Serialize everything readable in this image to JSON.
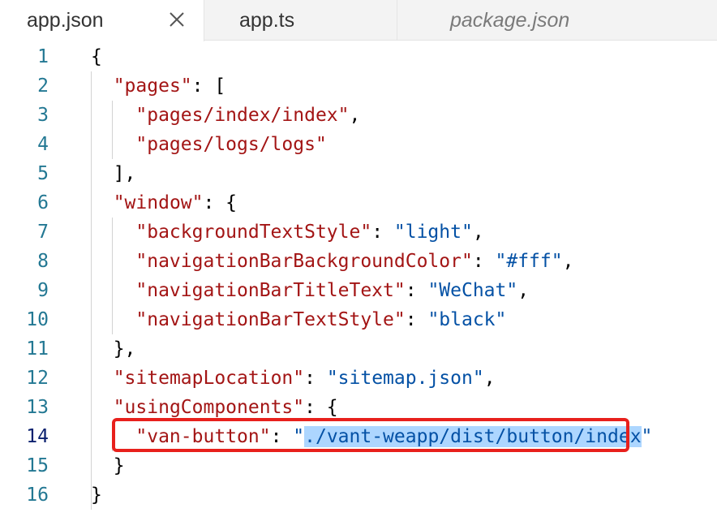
{
  "tabs": [
    {
      "label": "app.json",
      "active": true
    },
    {
      "label": "app.ts",
      "active": false
    },
    {
      "label": "package.json",
      "active": false,
      "preview": true
    }
  ],
  "icons": {
    "tab_close": "close-icon"
  },
  "colors": {
    "key": "#a31515",
    "string": "#0451a5",
    "line_number": "#237893",
    "highlight_border": "#e8201c",
    "selection": "#add6ff"
  },
  "editor": {
    "current_line": 14,
    "lines": [
      {
        "num": "1",
        "parts": [
          {
            "t": "{",
            "c": "p"
          }
        ]
      },
      {
        "num": "2",
        "parts": [
          {
            "t": "  ",
            "c": "p"
          },
          {
            "t": "\"pages\"",
            "c": "k"
          },
          {
            "t": ": [",
            "c": "p"
          }
        ]
      },
      {
        "num": "3",
        "parts": [
          {
            "t": "    ",
            "c": "p"
          },
          {
            "t": "\"pages/index/index\"",
            "c": "k"
          },
          {
            "t": ",",
            "c": "p"
          }
        ]
      },
      {
        "num": "4",
        "parts": [
          {
            "t": "    ",
            "c": "p"
          },
          {
            "t": "\"pages/logs/logs\"",
            "c": "k"
          }
        ]
      },
      {
        "num": "5",
        "parts": [
          {
            "t": "  ],",
            "c": "p"
          }
        ]
      },
      {
        "num": "6",
        "parts": [
          {
            "t": "  ",
            "c": "p"
          },
          {
            "t": "\"window\"",
            "c": "k"
          },
          {
            "t": ": {",
            "c": "p"
          }
        ]
      },
      {
        "num": "7",
        "parts": [
          {
            "t": "    ",
            "c": "p"
          },
          {
            "t": "\"backgroundTextStyle\"",
            "c": "k"
          },
          {
            "t": ": ",
            "c": "p"
          },
          {
            "t": "\"light\"",
            "c": "s"
          },
          {
            "t": ",",
            "c": "p"
          }
        ]
      },
      {
        "num": "8",
        "parts": [
          {
            "t": "    ",
            "c": "p"
          },
          {
            "t": "\"navigationBarBackgroundColor\"",
            "c": "k"
          },
          {
            "t": ": ",
            "c": "p"
          },
          {
            "t": "\"#fff\"",
            "c": "s"
          },
          {
            "t": ",",
            "c": "p"
          }
        ]
      },
      {
        "num": "9",
        "parts": [
          {
            "t": "    ",
            "c": "p"
          },
          {
            "t": "\"navigationBarTitleText\"",
            "c": "k"
          },
          {
            "t": ": ",
            "c": "p"
          },
          {
            "t": "\"WeChat\"",
            "c": "s"
          },
          {
            "t": ",",
            "c": "p"
          }
        ]
      },
      {
        "num": "10",
        "parts": [
          {
            "t": "    ",
            "c": "p"
          },
          {
            "t": "\"navigationBarTextStyle\"",
            "c": "k"
          },
          {
            "t": ": ",
            "c": "p"
          },
          {
            "t": "\"black\"",
            "c": "s"
          }
        ]
      },
      {
        "num": "11",
        "parts": [
          {
            "t": "  },",
            "c": "p"
          }
        ]
      },
      {
        "num": "12",
        "parts": [
          {
            "t": "  ",
            "c": "p"
          },
          {
            "t": "\"sitemapLocation\"",
            "c": "k"
          },
          {
            "t": ": ",
            "c": "p"
          },
          {
            "t": "\"sitemap.json\"",
            "c": "s"
          },
          {
            "t": ",",
            "c": "p"
          }
        ]
      },
      {
        "num": "13",
        "parts": [
          {
            "t": "  ",
            "c": "p"
          },
          {
            "t": "\"usingComponents\"",
            "c": "k"
          },
          {
            "t": ": {",
            "c": "p"
          }
        ]
      },
      {
        "num": "14",
        "parts": [
          {
            "t": "    ",
            "c": "p"
          },
          {
            "t": "\"van-button\"",
            "c": "k"
          },
          {
            "t": ": ",
            "c": "p"
          },
          {
            "t": "\"",
            "c": "s"
          },
          {
            "t": "./vant-weapp/dist/button/index",
            "c": "sel"
          },
          {
            "t": "\"",
            "c": "s"
          }
        ]
      },
      {
        "num": "15",
        "parts": [
          {
            "t": "  }",
            "c": "p"
          }
        ]
      },
      {
        "num": "16",
        "parts": [
          {
            "t": "}",
            "c": "p"
          }
        ]
      }
    ]
  }
}
